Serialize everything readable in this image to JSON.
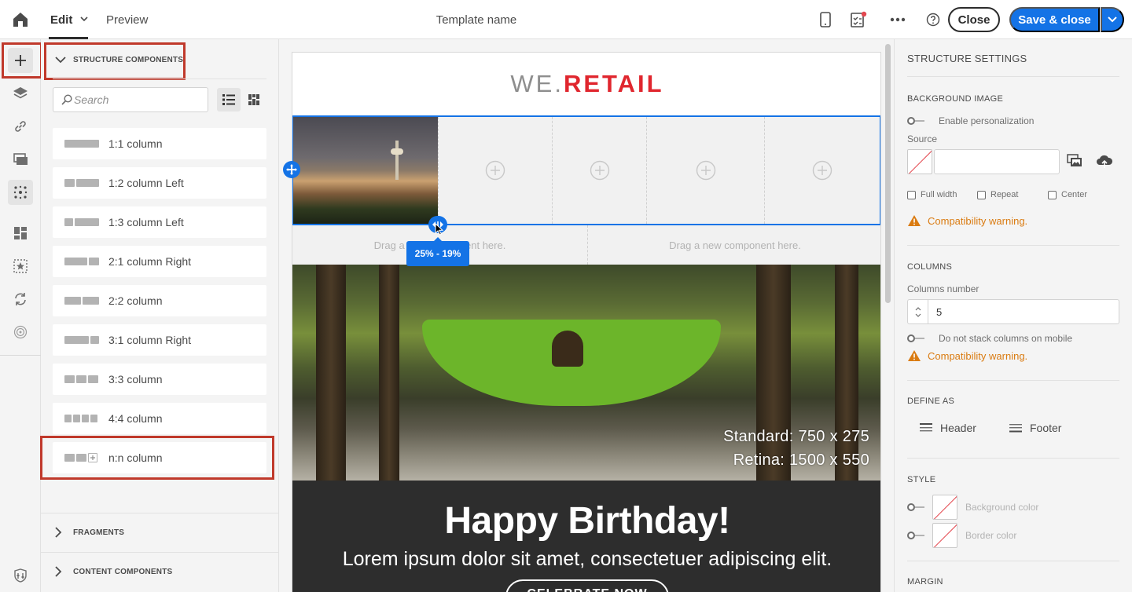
{
  "topbar": {
    "tab_edit": "Edit",
    "tab_preview": "Preview",
    "template_name": "Template name",
    "close_label": "Close",
    "save_label": "Save & close"
  },
  "left_panel": {
    "structure_header": "STRUCTURE COMPONENTS",
    "search_placeholder": "Search",
    "components": [
      {
        "label": "1:1 column"
      },
      {
        "label": "1:2 column Left"
      },
      {
        "label": "1:3 column Left"
      },
      {
        "label": "2:1 column Right"
      },
      {
        "label": "2:2 column"
      },
      {
        "label": "3:1 column Right"
      },
      {
        "label": "3:3 column"
      },
      {
        "label": "4:4 column"
      },
      {
        "label": "n:n column"
      }
    ],
    "fragments_header": "FRAGMENTS",
    "content_header": "CONTENT COMPONENTS"
  },
  "canvas": {
    "logo_we": "WE.",
    "logo_retail": "RETAIL",
    "drag_left": "Drag a new component here.",
    "drag_right": "Drag a new component here.",
    "resize_tooltip": "25% - 19%",
    "image_dims_standard": "Standard: 750 x 275",
    "image_dims_retina": "Retina: 1500 x 550",
    "headline": "Happy Birthday!",
    "subline": "Lorem ipsum dolor sit amet, consectetuer adipiscing elit.",
    "cta": "CELEBRATE NOW"
  },
  "right_panel": {
    "title": "STRUCTURE SETTINGS",
    "bg_image_head": "BACKGROUND IMAGE",
    "enable_personalization": "Enable personalization",
    "source_label": "Source",
    "full_width": "Full width",
    "repeat": "Repeat",
    "center": "Center",
    "compat_warning_1": "Compatibility warning.",
    "columns_head": "COLUMNS",
    "columns_number_label": "Columns number",
    "columns_number_value": "5",
    "no_stack": "Do not stack columns on mobile",
    "compat_warning_2": "Compatibility warning.",
    "define_head": "DEFINE AS",
    "header_btn": "Header",
    "footer_btn": "Footer",
    "style_head": "STYLE",
    "background_color": "Background color",
    "border_color": "Border color",
    "margin_head": "MARGIN"
  },
  "colors": {
    "accent": "#1473e6",
    "warning": "#da7b11",
    "highlight": "#c0392b",
    "logo_red": "#e0262e"
  }
}
